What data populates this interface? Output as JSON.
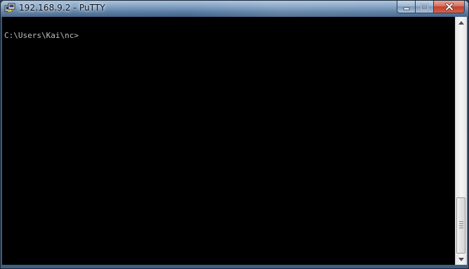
{
  "window": {
    "title": "192.168.9.2 - PuTTY",
    "icon": "putty-icon"
  },
  "controls": {
    "minimize_icon": "minimize-icon",
    "maximize_icon": "maximize-icon",
    "close_icon": "close-icon"
  },
  "terminal": {
    "prompt": "C:\\Users\\Kai\\nc>",
    "background": "#000000",
    "foreground": "#bfbfbf"
  },
  "scrollbar": {
    "position_fraction": 1.0
  }
}
